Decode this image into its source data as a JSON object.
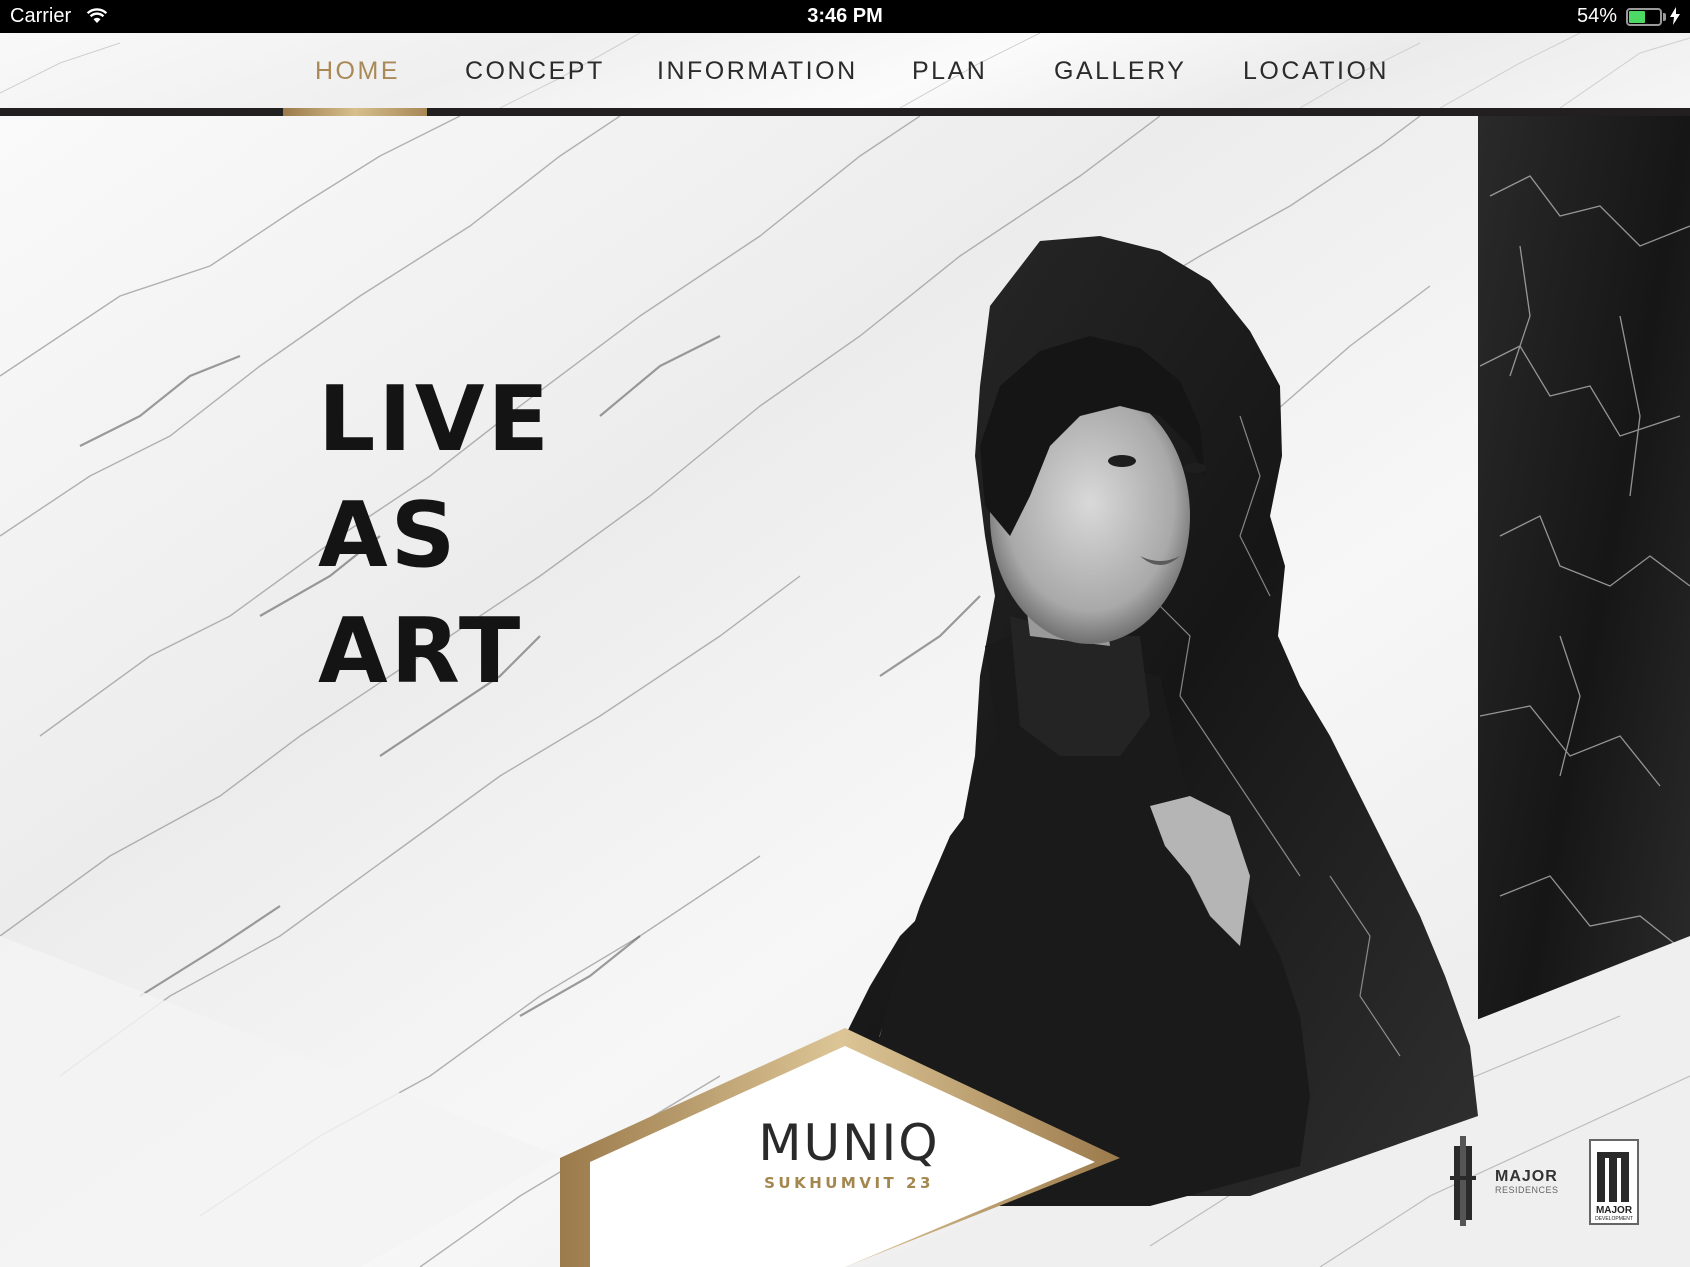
{
  "status_bar": {
    "carrier": "Carrier",
    "time": "3:46 PM",
    "battery_percent": "54%",
    "battery_level": 0.54,
    "icons": [
      "wifi-icon",
      "battery-icon",
      "charging-bolt-icon"
    ]
  },
  "nav": {
    "items": [
      {
        "label": "HOME",
        "active": true
      },
      {
        "label": "CONCEPT",
        "active": false
      },
      {
        "label": "INFORMATION",
        "active": false
      },
      {
        "label": "PLAN",
        "active": false
      },
      {
        "label": "GALLERY",
        "active": false
      },
      {
        "label": "LOCATION",
        "active": false
      }
    ]
  },
  "hero": {
    "headline": [
      "LIVE",
      "AS",
      "ART"
    ]
  },
  "brand": {
    "name": "MUNIQ",
    "subtitle": "SUKHUMVIT 23"
  },
  "partners": {
    "major_residences": {
      "line1": "MAJOR",
      "line2": "RESIDENCES"
    },
    "major_development": {
      "line1": "MAJOR",
      "line2": "DEVELOPMENT"
    }
  },
  "colors": {
    "accent_gold": "#a98958",
    "nav_text": "#2b2b2b",
    "dark": "#221f20",
    "battery_green": "#4cd964"
  }
}
